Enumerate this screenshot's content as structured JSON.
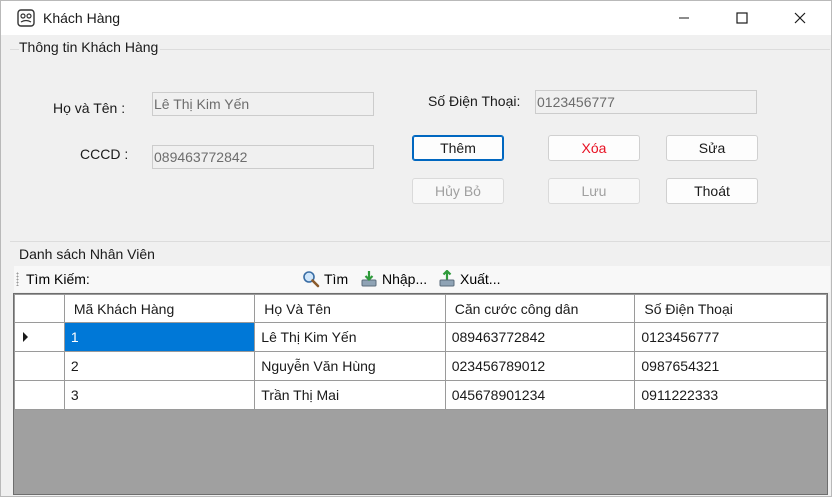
{
  "window": {
    "title": "Khách Hàng",
    "controls": [
      "minimize-icon",
      "maximize-icon",
      "close-icon"
    ]
  },
  "info_group": {
    "title": "Thông tin Khách Hàng",
    "name_label": "Họ và Tên :",
    "name_value": "Lê Thị Kim Yến",
    "phone_label": "Số Điện Thoại:",
    "phone_value": "0123456777",
    "cccd_label": "CCCD :",
    "cccd_value": "089463772842"
  },
  "buttons": {
    "add": "Thêm",
    "delete": "Xóa",
    "edit": "Sửa",
    "cancel": "Hủy Bỏ",
    "save": "Lưu",
    "exit": "Thoát"
  },
  "list_group": {
    "title": "Danh sách Nhân Viên"
  },
  "toolbar": {
    "search_label": "Tìm Kiếm:",
    "search_value": "",
    "find": "Tìm",
    "import": "Nhập...",
    "export": "Xuất..."
  },
  "table": {
    "columns": [
      "Mã Khách Hàng",
      "Họ Và Tên",
      "Căn cước công dân",
      "Số Điện Thoại"
    ],
    "rows": [
      [
        "1",
        "Lê Thị Kim Yến",
        "089463772842",
        "0123456777"
      ],
      [
        "2",
        "Nguyễn Văn Hùng",
        "023456789012",
        "0987654321"
      ],
      [
        "3",
        "Trần Thị Mai",
        "045678901234",
        "0911222333"
      ]
    ],
    "selected_row": 0
  },
  "colors": {
    "accent": "#0067c0",
    "selection": "#0078d7",
    "danger": "#e81123",
    "grid_background": "#a0a0a0"
  }
}
